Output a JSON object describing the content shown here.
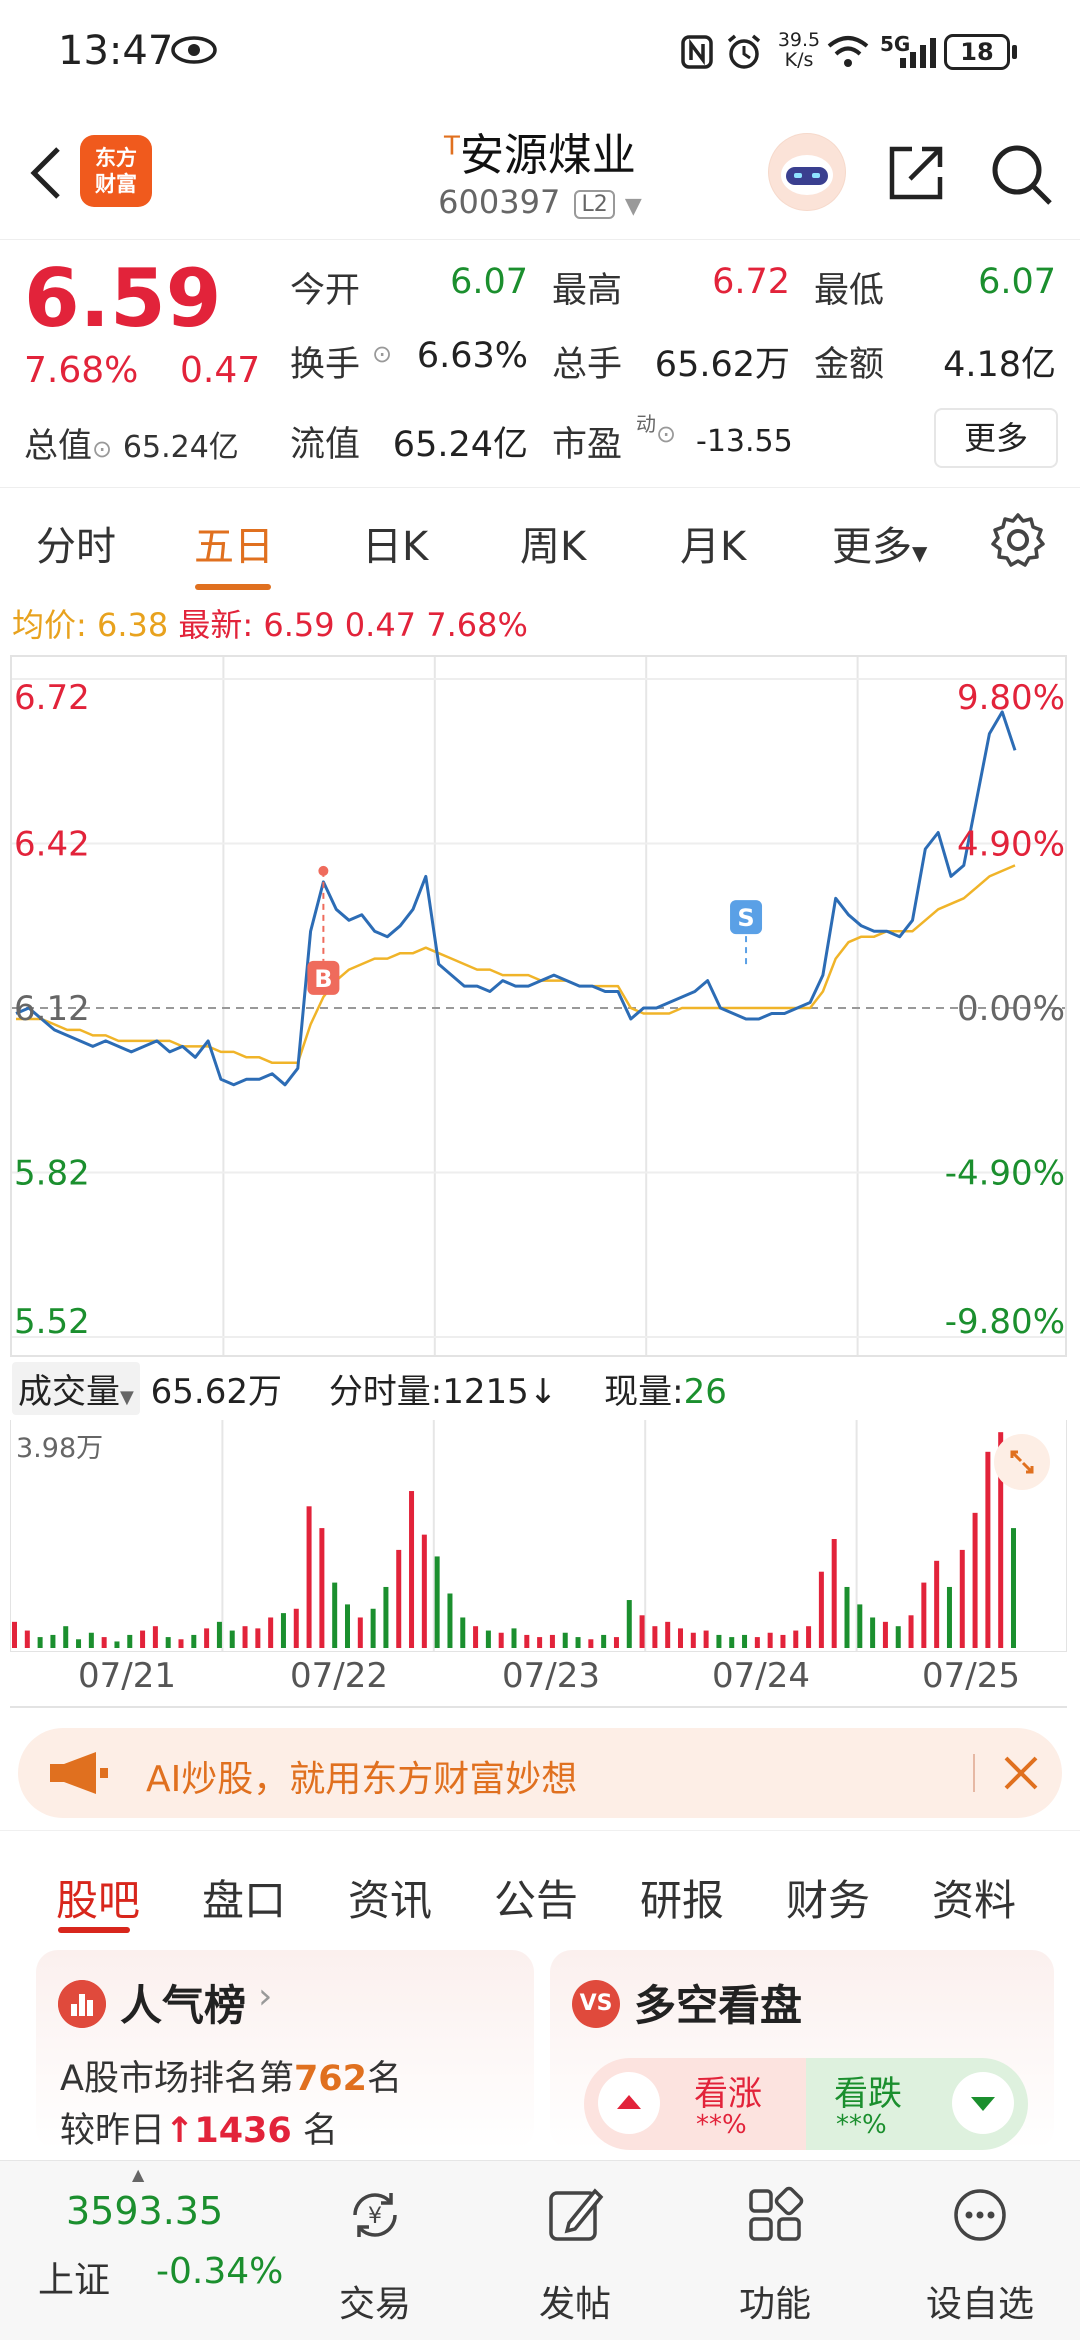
{
  "status_bar": {
    "time": "13:47",
    "net_speed_top": "39.5",
    "net_speed_unit": "K/s",
    "signal_label": "5G",
    "battery": "18"
  },
  "header": {
    "brand_line1": "东方",
    "brand_line2": "财富",
    "t_mark": "T",
    "stock_name": "安源煤业",
    "stock_code": "600397",
    "level_badge": "L2"
  },
  "quote": {
    "price": "6.59",
    "change_pct": "7.68%",
    "change": "0.47",
    "market_cap_label": "总值",
    "market_cap": "65.24亿",
    "open_label": "今开",
    "open": "6.07",
    "high_label": "最高",
    "high": "6.72",
    "low_label": "最低",
    "low": "6.07",
    "turnover_label": "换手",
    "turnover": "6.63%",
    "volume_label": "总手",
    "volume": "65.62万",
    "amount_label": "金额",
    "amount": "4.18亿",
    "float_cap_label": "流值",
    "float_cap": "65.24亿",
    "pe_label": "市盈",
    "pe_sup": "动",
    "pe": "-13.55",
    "more_button": "更多"
  },
  "chart_tabs": {
    "items": [
      "分时",
      "五日",
      "日K",
      "周K",
      "月K",
      "更多"
    ],
    "active": "五日"
  },
  "info_line": {
    "avg_label": "均价:",
    "avg": "6.38",
    "latest_label": "最新:",
    "latest": "6.59",
    "change": "0.47",
    "change_pct": "7.68%"
  },
  "chart_data": {
    "type": "line",
    "dates": [
      "07/21",
      "07/22",
      "07/23",
      "07/24",
      "07/25"
    ],
    "y_left_ticks": [
      "6.72",
      "6.42",
      "6.12",
      "5.82",
      "5.52"
    ],
    "y_right_ticks": [
      "9.80%",
      "4.90%",
      "0.00%",
      "-4.90%",
      "-9.80%"
    ],
    "ylim": [
      5.52,
      6.72
    ],
    "prev_close": 6.12,
    "series": [
      {
        "values": [
          6.11,
          6.12,
          6.1,
          6.08,
          6.07,
          6.06,
          6.05,
          6.06,
          6.05,
          6.04,
          6.05,
          6.06,
          6.04,
          6.05,
          6.03,
          6.06,
          5.99,
          5.98,
          5.99,
          5.99,
          6.0,
          5.98,
          6.01,
          6.26,
          6.35,
          6.3,
          6.28,
          6.29,
          6.26,
          6.25,
          6.27,
          6.3,
          6.36,
          6.2,
          6.18,
          6.16,
          6.16,
          6.15,
          6.17,
          6.16,
          6.16,
          6.17,
          6.18,
          6.17,
          6.16,
          6.16,
          6.15,
          6.15,
          6.1,
          6.12,
          6.12,
          6.13,
          6.14,
          6.15,
          6.17,
          6.12,
          6.11,
          6.1,
          6.1,
          6.11,
          6.11,
          6.12,
          6.13,
          6.18,
          6.32,
          6.29,
          6.27,
          6.26,
          6.26,
          6.25,
          6.28,
          6.41,
          6.44,
          6.36,
          6.38,
          6.5,
          6.62,
          6.66,
          6.59
        ]
      },
      {
        "values": [
          6.1,
          6.1,
          6.1,
          6.09,
          6.08,
          6.08,
          6.07,
          6.07,
          6.06,
          6.06,
          6.06,
          6.06,
          6.06,
          6.05,
          6.05,
          6.05,
          6.04,
          6.04,
          6.03,
          6.03,
          6.02,
          6.02,
          6.02,
          6.09,
          6.14,
          6.17,
          6.19,
          6.2,
          6.21,
          6.21,
          6.22,
          6.22,
          6.23,
          6.22,
          6.21,
          6.2,
          6.19,
          6.19,
          6.18,
          6.18,
          6.18,
          6.17,
          6.17,
          6.17,
          6.16,
          6.16,
          6.16,
          6.16,
          6.12,
          6.11,
          6.11,
          6.11,
          6.12,
          6.12,
          6.12,
          6.12,
          6.12,
          6.12,
          6.12,
          6.12,
          6.12,
          6.12,
          6.12,
          6.15,
          6.21,
          6.24,
          6.25,
          6.25,
          6.26,
          6.26,
          6.26,
          6.28,
          6.3,
          6.31,
          6.32,
          6.34,
          6.36,
          6.37,
          6.38
        ]
      }
    ],
    "markers": [
      {
        "label": "B",
        "value": 6.37
      },
      {
        "label": "S",
        "value": 6.2
      }
    ],
    "volume": {
      "max_label": "3.98万",
      "header_label": "成交量",
      "total": "65.62万",
      "minute_label": "分时量:",
      "minute": "1215",
      "minute_arrow": "↓",
      "current_label": "现量:",
      "current": "26",
      "bars": [
        0.12,
        0.08,
        0.05,
        0.06,
        0.1,
        0.04,
        0.07,
        0.05,
        0.03,
        0.06,
        0.08,
        0.1,
        0.05,
        0.04,
        0.06,
        0.09,
        0.12,
        0.08,
        0.1,
        0.09,
        0.14,
        0.16,
        0.18,
        0.65,
        0.55,
        0.3,
        0.2,
        0.14,
        0.18,
        0.28,
        0.45,
        0.72,
        0.52,
        0.42,
        0.25,
        0.14,
        0.1,
        0.08,
        0.07,
        0.09,
        0.06,
        0.05,
        0.06,
        0.07,
        0.05,
        0.04,
        0.06,
        0.05,
        0.22,
        0.15,
        0.1,
        0.12,
        0.09,
        0.07,
        0.08,
        0.06,
        0.05,
        0.06,
        0.05,
        0.07,
        0.06,
        0.08,
        0.1,
        0.35,
        0.5,
        0.28,
        0.2,
        0.14,
        0.12,
        0.1,
        0.15,
        0.3,
        0.4,
        0.28,
        0.45,
        0.62,
        0.9,
        0.99,
        0.55
      ]
    }
  },
  "ai_banner": {
    "text": "AI炒股，就用东方财富妙想"
  },
  "section_tabs": {
    "items": [
      "股吧",
      "盘口",
      "资讯",
      "公告",
      "研报",
      "财务",
      "资料"
    ],
    "active": "股吧"
  },
  "popularity_card": {
    "title": "人气榜",
    "line1_prefix": "A股市场排名第",
    "rank": "762",
    "line1_suffix": "名",
    "line2_prefix": "较昨日",
    "rank_change": "1436",
    "line2_suffix": "名"
  },
  "long_short_card": {
    "badge": "VS",
    "title": "多空看盘",
    "bull_label": "看涨",
    "bull_value": "**%",
    "bear_label": "看跌",
    "bear_value": "**%"
  },
  "bottom_nav": {
    "index_value": "3593.35",
    "index_name": "上证",
    "index_change": "-0.34%",
    "items": [
      "交易",
      "发帖",
      "功能",
      "设自选"
    ]
  },
  "colors": {
    "up": "#e2233a",
    "down": "#1b8f2e",
    "accent": "#e0701f",
    "price_line": "#2c6cb5",
    "avg_line": "#f0b429"
  }
}
